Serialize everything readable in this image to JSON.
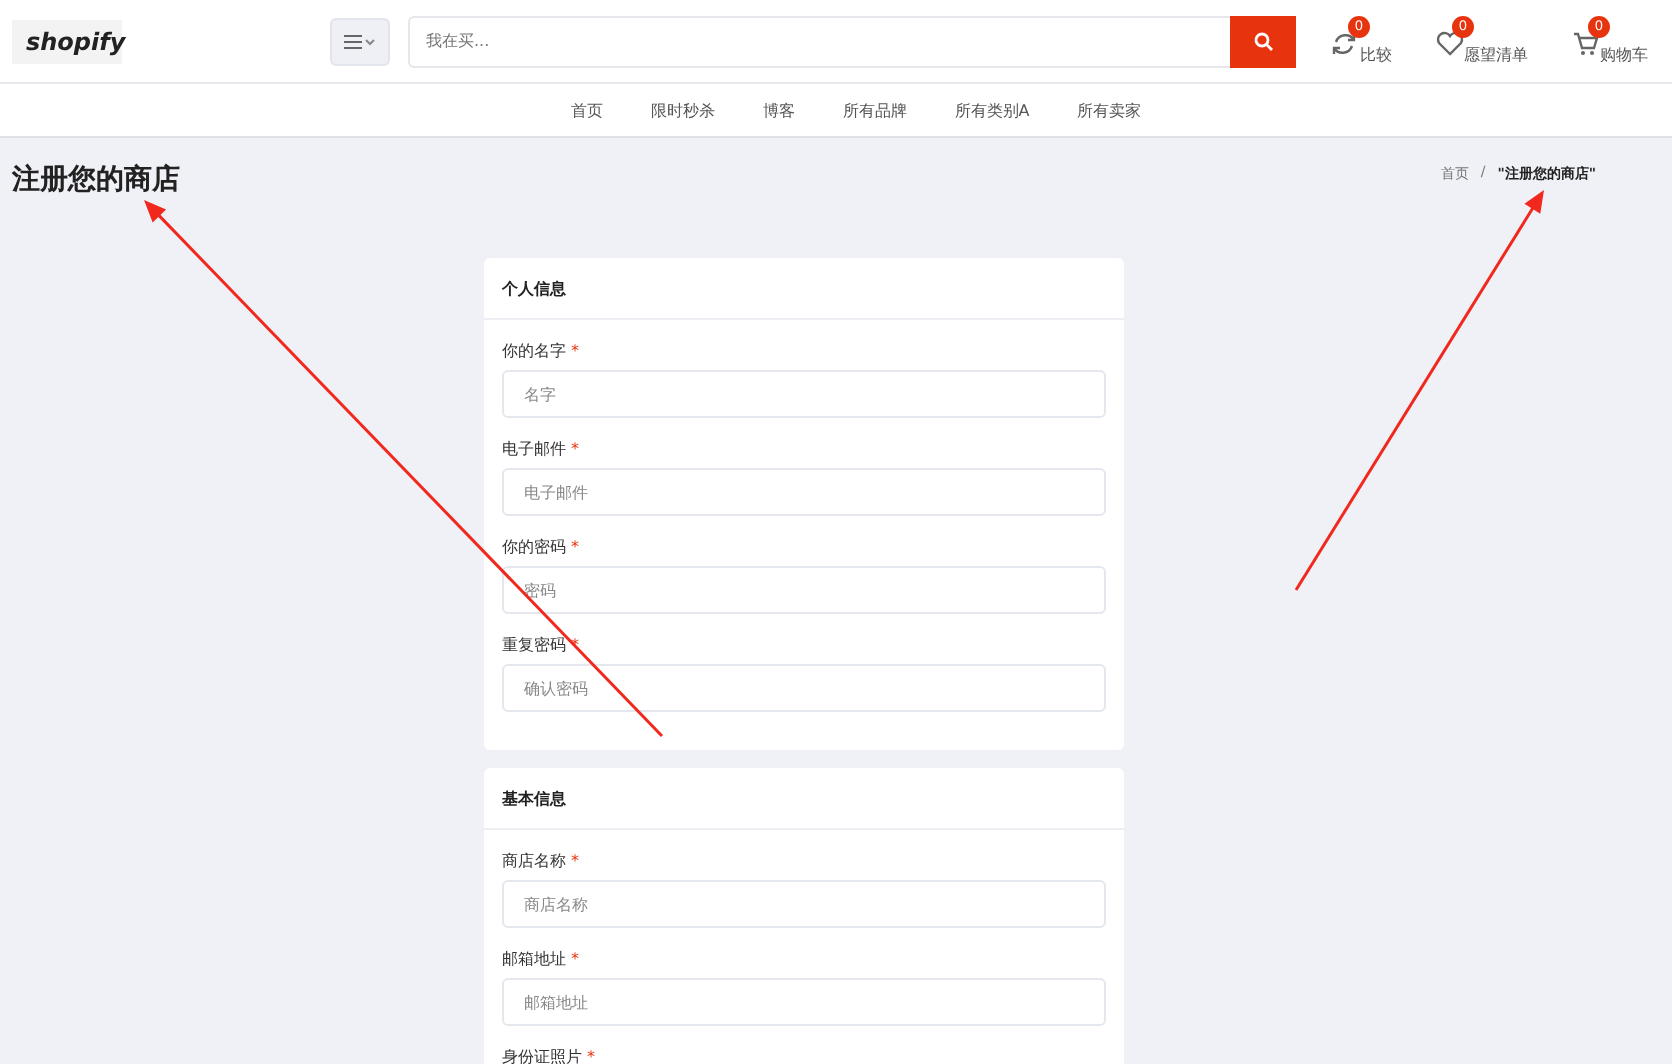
{
  "header": {
    "logo": "shopify",
    "search": {
      "placeholder": "我在买..."
    },
    "actions": [
      {
        "kind": "compare",
        "label": "比较",
        "count": "0"
      },
      {
        "kind": "wishlist",
        "label": "愿望清单",
        "count": "0"
      },
      {
        "kind": "cart",
        "label": "购物车",
        "count": "0"
      }
    ]
  },
  "nav": [
    "首页",
    "限时秒杀",
    "博客",
    "所有品牌",
    "所有类别A",
    "所有卖家"
  ],
  "page": {
    "title": "注册您的商店",
    "breadcrumb": [
      "首页",
      "/",
      "\"注册您的商店\""
    ]
  },
  "sections": [
    {
      "title": "个人信息",
      "fields": [
        {
          "label": "你的名字",
          "required_mark": "*",
          "placeholder": "名字"
        },
        {
          "label": "电子邮件",
          "required_mark": "*",
          "placeholder": "电子邮件"
        },
        {
          "label": "你的密码",
          "required_mark": "*",
          "placeholder": "密码"
        },
        {
          "label": "重复密码",
          "required_mark": "*",
          "placeholder": "确认密码"
        }
      ]
    },
    {
      "title": "基本信息",
      "fields": [
        {
          "label": "商店名称",
          "required_mark": "*",
          "placeholder": "商店名称"
        },
        {
          "label": "邮箱地址",
          "required_mark": "*",
          "placeholder": "邮箱地址"
        },
        {
          "label": "身份证照片",
          "required_mark": "*"
        }
      ]
    }
  ],
  "annotations": [
    {
      "kind": "arrow"
    },
    {
      "kind": "arrow"
    }
  ]
}
